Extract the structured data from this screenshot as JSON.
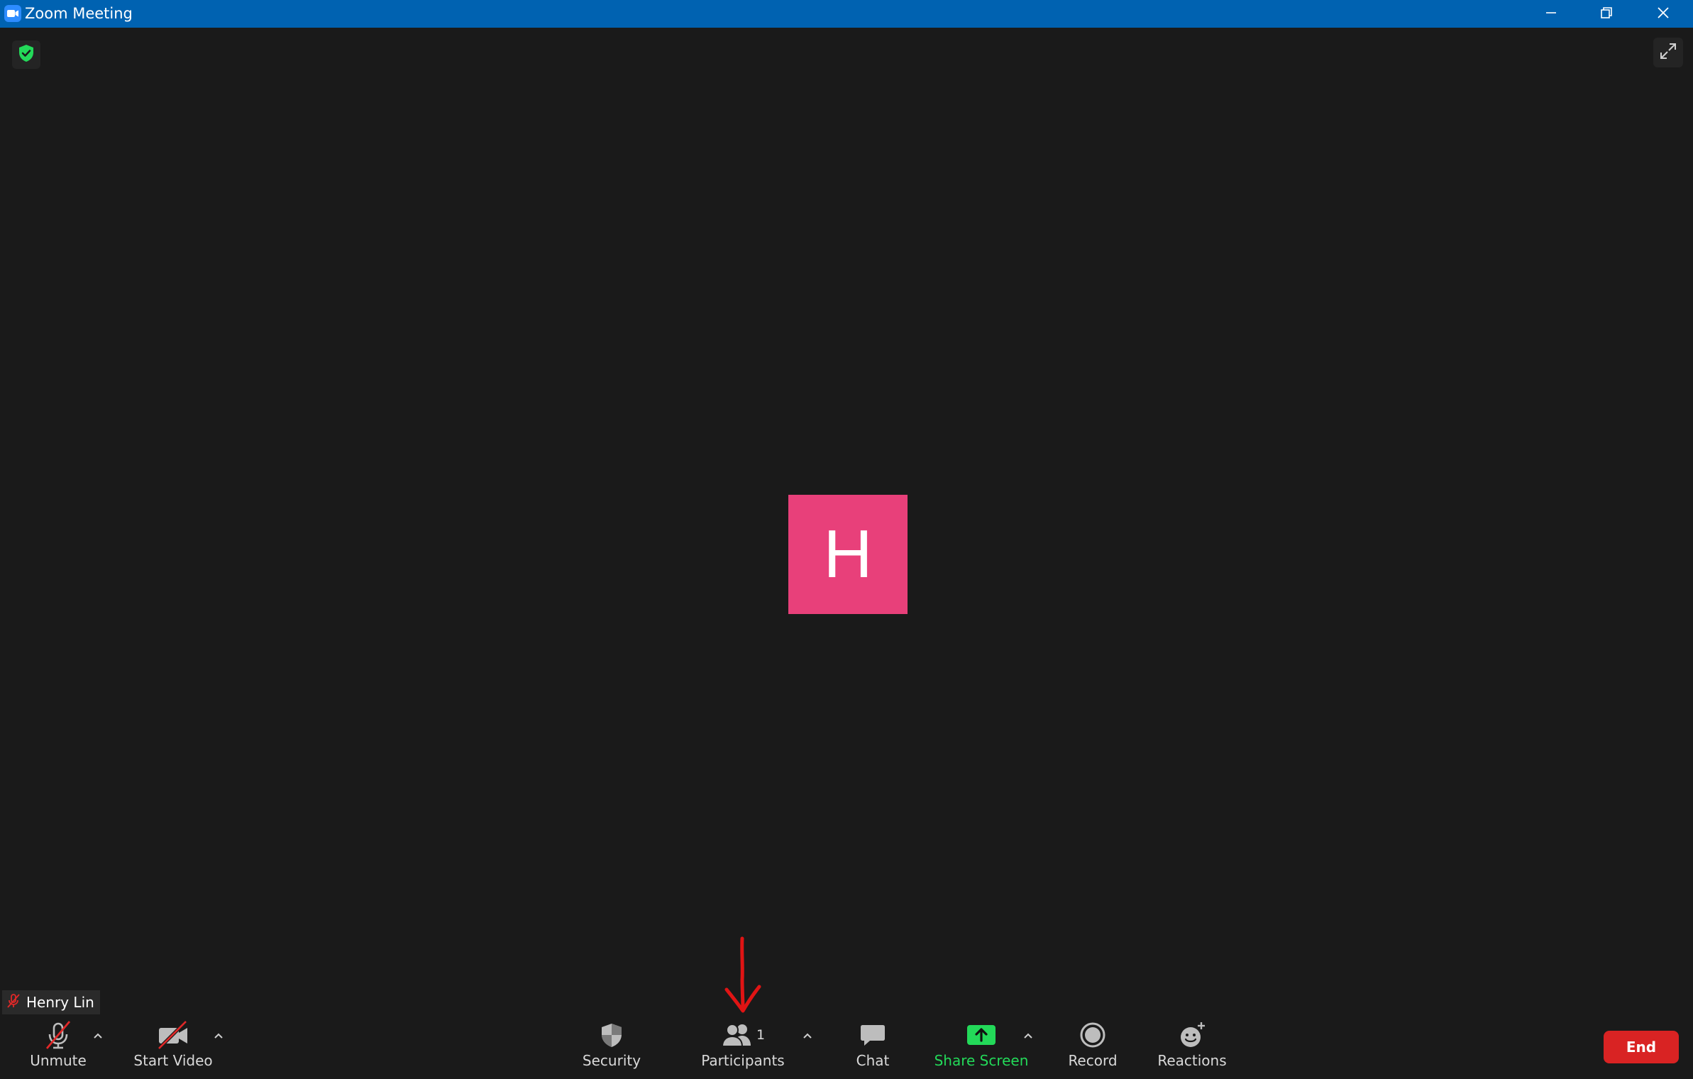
{
  "window": {
    "title": "Zoom Meeting",
    "titlebar_color": "#0062b1",
    "controls": [
      "minimize-icon",
      "restore-icon",
      "close-icon"
    ]
  },
  "meeting": {
    "background_color": "#1a1a1a",
    "encryption_icon": "shield-check-icon",
    "encryption_color": "#23d959",
    "fullscreen_icon": "expand-icon"
  },
  "participant": {
    "avatar_initial": "H",
    "avatar_color": "#e8407a",
    "name": "Henry Lin",
    "muted": true,
    "muted_icon": "mic-off-icon"
  },
  "toolbar": {
    "unmute_label": "Unmute",
    "start_video_label": "Start Video",
    "security_label": "Security",
    "participants_label": "Participants",
    "participants_count": "1",
    "chat_label": "Chat",
    "share_screen_label": "Share Screen",
    "share_screen_color": "#23d959",
    "record_label": "Record",
    "reactions_label": "Reactions",
    "end_label": "End",
    "end_color": "#d92323"
  },
  "annotation": {
    "icon": "red-arrow-down-icon",
    "color": "#e01414",
    "points_to": "Participants"
  }
}
